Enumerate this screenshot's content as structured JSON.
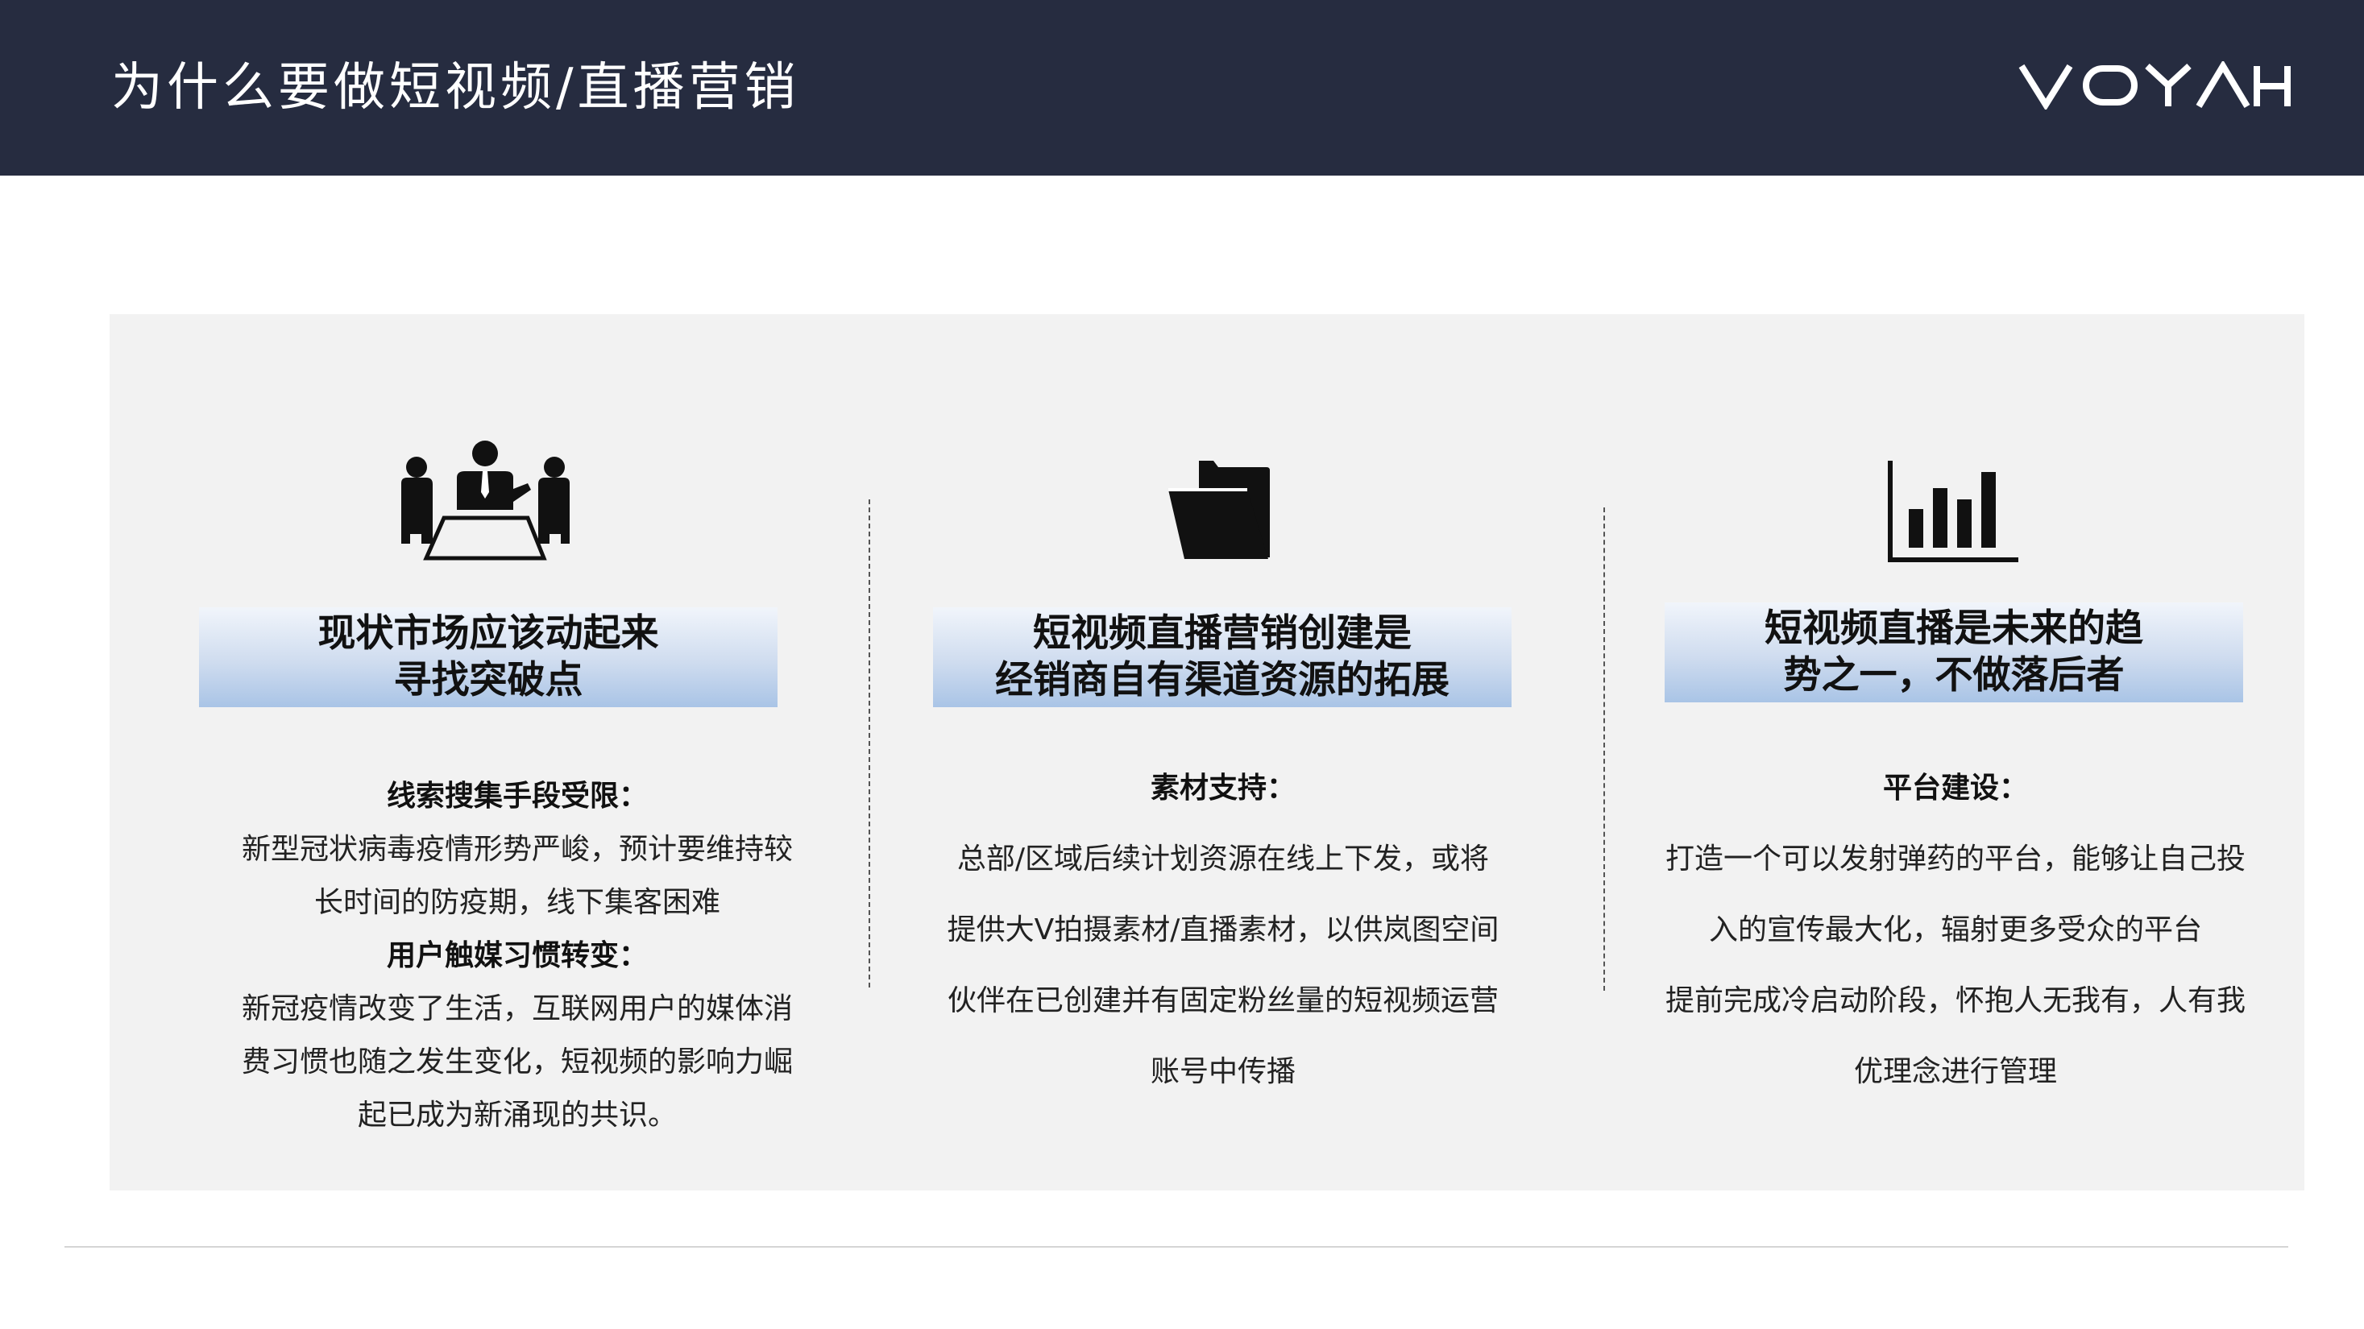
{
  "header": {
    "title": "为什么要做短视频/直播营销",
    "brand": "VOYAH",
    "background_color": "#262c40",
    "title_color": "#ffffff"
  },
  "panel": {
    "background_color": "#f2f2f2",
    "columns": [
      {
        "icon": "meeting-people-icon",
        "heading": [
          "现状市场应该动起来",
          "寻找突破点"
        ],
        "paragraphs": [
          {
            "text": "线索搜集手段受限：",
            "bold": true
          },
          {
            "text": "新型冠状病毒疫情形势严峻，预计要维持较",
            "bold": false
          },
          {
            "text": "长时间的防疫期，线下集客困难",
            "bold": false
          },
          {
            "text": "用户触媒习惯转变：",
            "bold": true
          },
          {
            "text": "新冠疫情改变了生活，互联网用户的媒体消",
            "bold": false
          },
          {
            "text": "费习惯也随之发生变化，短视频的影响力崛",
            "bold": false
          },
          {
            "text": "起已成为新涌现的共识。",
            "bold": false
          }
        ]
      },
      {
        "icon": "folder-icon",
        "heading": [
          "短视频直播营销创建是",
          "经销商自有渠道资源的拓展"
        ],
        "paragraphs": [
          {
            "text": "素材支持：",
            "bold": true
          },
          {
            "text": "总部/区域后续计划资源在线上下发，或将",
            "bold": false
          },
          {
            "text": "提供大V拍摄素材/直播素材，以供岚图空间",
            "bold": false
          },
          {
            "text": "伙伴在已创建并有固定粉丝量的短视频运营",
            "bold": false
          },
          {
            "text": "账号中传播",
            "bold": false
          }
        ]
      },
      {
        "icon": "bar-chart-icon",
        "heading": [
          "短视频直播是未来的趋",
          "势之一，不做落后者"
        ],
        "paragraphs": [
          {
            "text": "平台建设：",
            "bold": true
          },
          {
            "text": "打造一个可以发射弹药的平台，能够让自己投",
            "bold": false
          },
          {
            "text": "入的宣传最大化，辐射更多受众的平台",
            "bold": false
          },
          {
            "text": "提前完成冷启动阶段，怀抱人无我有，人有我",
            "bold": false
          },
          {
            "text": "优理念进行管理",
            "bold": false
          }
        ]
      }
    ]
  }
}
